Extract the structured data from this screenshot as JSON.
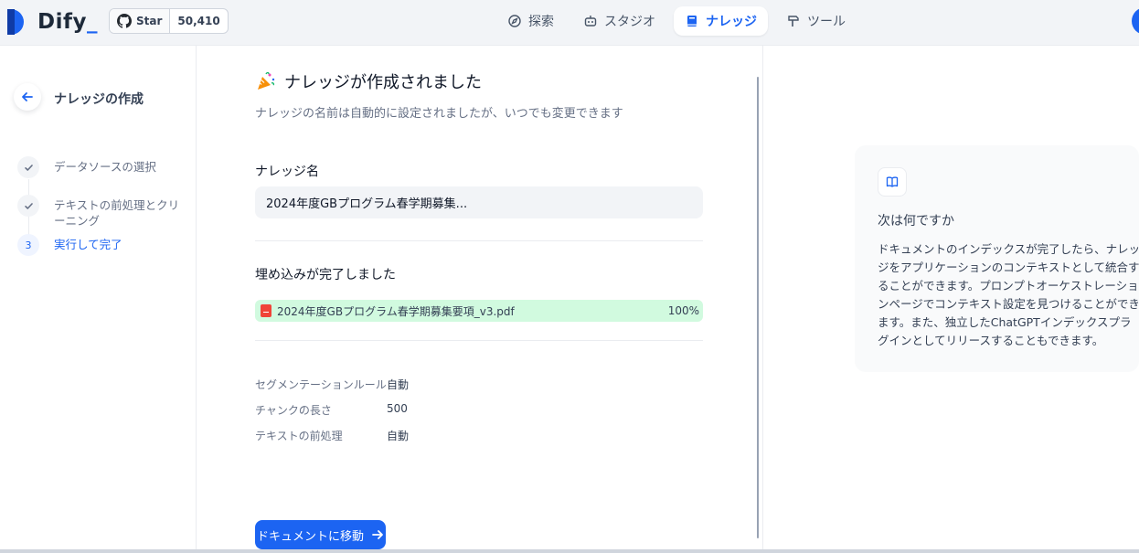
{
  "header": {
    "logo_text": "Dify",
    "github": {
      "star_label": "Star",
      "star_count": "50,410"
    },
    "nav": [
      {
        "label": "探索",
        "icon": "compass-icon"
      },
      {
        "label": "スタジオ",
        "icon": "robot-icon"
      },
      {
        "label": "ナレッジ",
        "icon": "book-icon",
        "active": true
      },
      {
        "label": "ツール",
        "icon": "hammer-icon"
      }
    ]
  },
  "sidebar": {
    "title": "ナレッジの作成",
    "steps": [
      {
        "label": "データソースの選択",
        "state": "done"
      },
      {
        "label": "テキストの前処理とクリーニング",
        "state": "done"
      },
      {
        "num": "3",
        "label": "実行して完了",
        "state": "current"
      }
    ]
  },
  "main": {
    "title": "ナレッジが作成されました",
    "subtitle": "ナレッジの名前は自動的に設定されましたが、いつでも変更できます",
    "name_label": "ナレッジ名",
    "name_value": "2024年度GBプログラム春学期募集...",
    "embed_label": "埋め込みが完了しました",
    "file": {
      "name": "2024年度GBプログラム春学期募集要項_v3.pdf",
      "progress": "100%"
    },
    "info": [
      {
        "key": "セグメンテーションルール",
        "value": "自動"
      },
      {
        "key": "チャンクの長さ",
        "value": "500"
      },
      {
        "key": "テキストの前処理",
        "value": "自動"
      }
    ],
    "cta_label": "ドキュメントに移動"
  },
  "next": {
    "title": "次は何ですか",
    "description": "ドキュメントのインデックスが完了したら、ナレッジをアプリケーションのコンテキストとして統合することができます。プロンプトオーケストレーションページでコンテキスト設定を見つけることができます。また、独立したChatGPTインデックスプラグインとしてリリースすることもできます。"
  },
  "colors": {
    "accent": "#1c64f2",
    "success_bg": "#d1fadf"
  }
}
